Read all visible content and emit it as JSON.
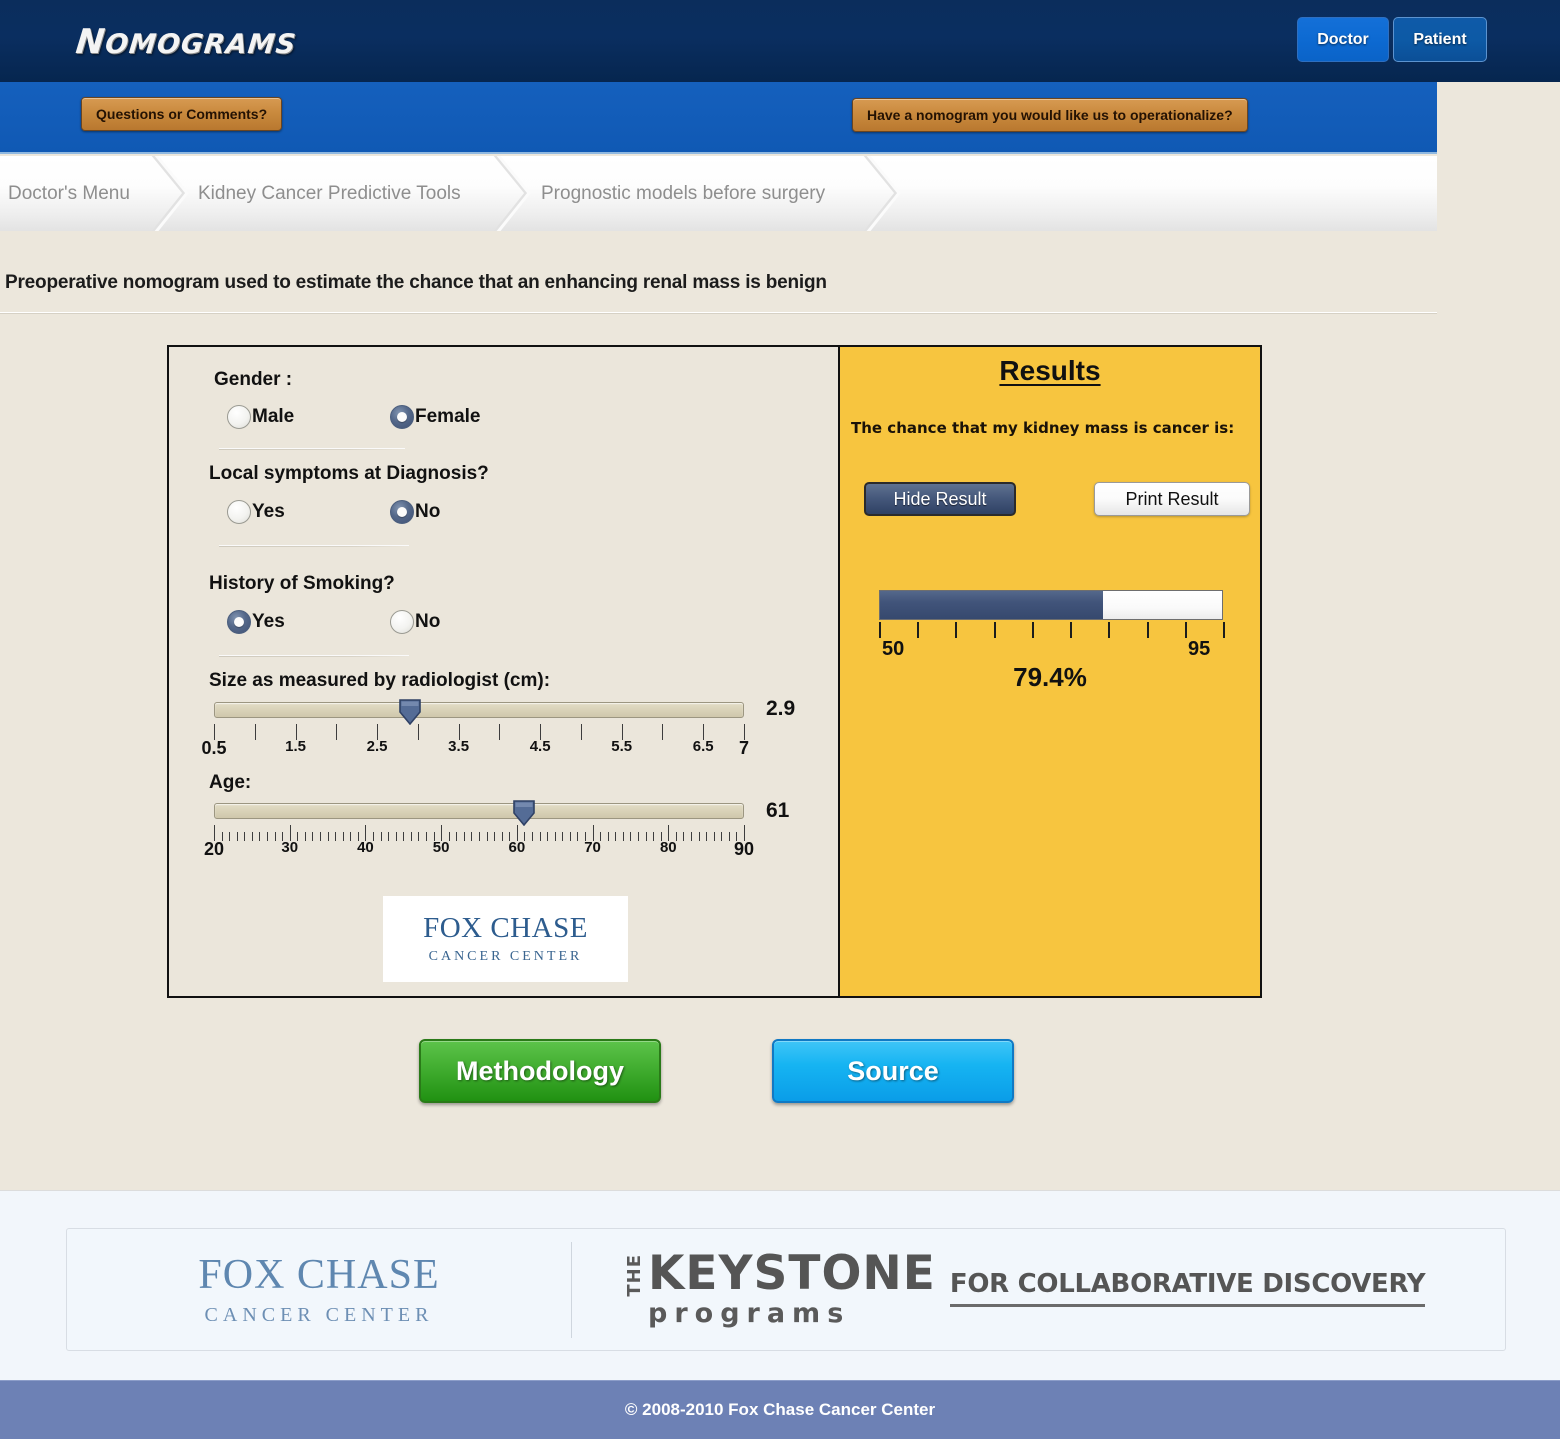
{
  "header": {
    "brand": "Nomograms",
    "audience_buttons": [
      {
        "label": "Doctor",
        "name": "doctor"
      },
      {
        "label": "Patient",
        "name": "patient"
      }
    ]
  },
  "subbar": {
    "questions_label": "Questions or Comments?",
    "operationalize_label": "Have a nomogram you would like us to operationalize?"
  },
  "breadcrumb": {
    "items": [
      {
        "label": "Doctor's Menu"
      },
      {
        "label": "Kidney Cancer Predictive Tools"
      },
      {
        "label": "Prognostic models before surgery"
      }
    ]
  },
  "page": {
    "title": "Preoperative nomogram used to estimate the chance that an enhancing renal mass is benign"
  },
  "form": {
    "gender": {
      "label": "Gender :",
      "options": [
        {
          "label": "Male",
          "checked": false
        },
        {
          "label": "Female",
          "checked": true
        }
      ]
    },
    "local_symptoms": {
      "label": "Local symptoms at Diagnosis?",
      "options": [
        {
          "label": "Yes",
          "checked": false
        },
        {
          "label": "No",
          "checked": true
        }
      ]
    },
    "smoking": {
      "label": "History of Smoking?",
      "options": [
        {
          "label": "Yes",
          "checked": true
        },
        {
          "label": "No",
          "checked": false
        }
      ]
    },
    "size_slider": {
      "label": "Size as measured by radiologist (cm):",
      "value": "2.9",
      "min": 0.5,
      "max": 7,
      "tick_step": 0.5,
      "tick_labels": [
        "0.5",
        "1.5",
        "2.5",
        "3.5",
        "4.5",
        "5.5",
        "6.5",
        "7"
      ],
      "tick_label_values": [
        0.5,
        1.5,
        2.5,
        3.5,
        4.5,
        5.5,
        6.5,
        7
      ]
    },
    "age_slider": {
      "label": "Age:",
      "value": "61",
      "min": 20,
      "max": 90,
      "tick_step": 1,
      "tick_labels": [
        "20",
        "30",
        "40",
        "50",
        "60",
        "70",
        "80",
        "90"
      ],
      "tick_label_values": [
        20,
        30,
        40,
        50,
        60,
        70,
        80,
        90
      ]
    },
    "logo": {
      "top": "FOX CHASE",
      "bottom": "CANCER CENTER"
    }
  },
  "results": {
    "title": "Results",
    "subtitle": "The chance that my kidney mass is cancer is:",
    "hide_label": "Hide Result",
    "print_label": "Print Result",
    "percent_label": "79.4%",
    "percent_value": 79.4,
    "bar_min_label": "50",
    "bar_max_label": "95",
    "bar_min": 50,
    "bar_max": 95,
    "bar_tick_count": 10
  },
  "actions": {
    "methodology_label": "Methodology",
    "source_label": "Source"
  },
  "footer": {
    "fox_chase": {
      "top": "FOX CHASE",
      "bottom": "CANCER CENTER"
    },
    "keystone": {
      "the": "THE",
      "name": "KEYSTONE",
      "programs": "programs",
      "tagline": "FOR COLLABORATIVE DISCOVERY"
    },
    "copyright": "© 2008-2010 Fox Chase Cancer Center"
  },
  "colors": {
    "header_navy": "#0a2e60",
    "subbar_blue": "#1059b4",
    "panel_bg": "#ebe6db",
    "results_gold": "#f7c53f",
    "bar_fill": "#41547a",
    "methodology_green": "#45b033",
    "source_blue": "#16b4f2",
    "copyright_band": "#6d81b5"
  }
}
